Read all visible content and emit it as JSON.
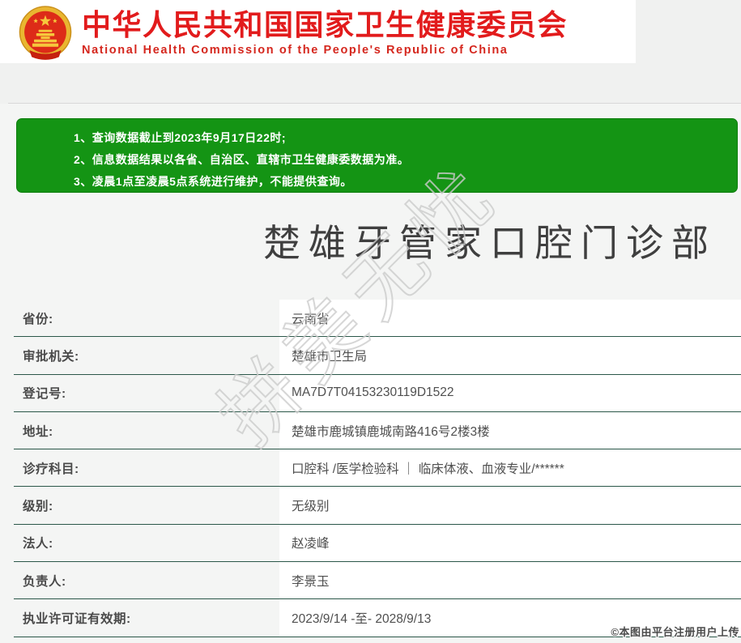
{
  "page": {
    "bg_color": "#f0f1f0",
    "divider_color": "#d8d8d8"
  },
  "header": {
    "emblem_icon": "china-national-emblem",
    "title_cn": "中华人民共和国国家卫生健康委员会",
    "title_en": "National Health Commission of the People's Republic of China",
    "brand_red": "#e21b1c",
    "bg_color": "#ffffff"
  },
  "notice": {
    "bg_color": "#149414",
    "border_color": "#0e7d0e",
    "lines": [
      "1、查询数据截止到2023年9月17日22时;",
      "2、信息数据结果以各省、自治区、直辖市卫生健康委数据为准。",
      "3、凌晨1点至凌晨5点系统进行维护，不能提供查询。"
    ]
  },
  "institution": {
    "name": "楚雄牙管家口腔门诊部",
    "separator_color": "#2b5749",
    "fields": [
      {
        "label": "省份:",
        "value": "云南省"
      },
      {
        "label": "审批机关:",
        "value": "楚雄市卫生局"
      },
      {
        "label": "登记号:",
        "value": "MA7D7T04153230119D1522"
      },
      {
        "label": "地址:",
        "value": "楚雄市鹿城镇鹿城南路416号2楼3楼"
      },
      {
        "label": "诊疗科目:",
        "value": "口腔科 /医学检验科 ｜ 临床体液、血液专业/******"
      },
      {
        "label": "级别:",
        "value": "无级别"
      },
      {
        "label": "法人:",
        "value": "赵凌峰"
      },
      {
        "label": "负责人:",
        "value": "李景玉"
      },
      {
        "label": "执业许可证有效期:",
        "value": "2023/9/14 -至- 2028/9/13"
      }
    ]
  },
  "watermark": {
    "text": "拼美无忧"
  },
  "footer": {
    "credit": "©本图由平台注册用户上传"
  }
}
